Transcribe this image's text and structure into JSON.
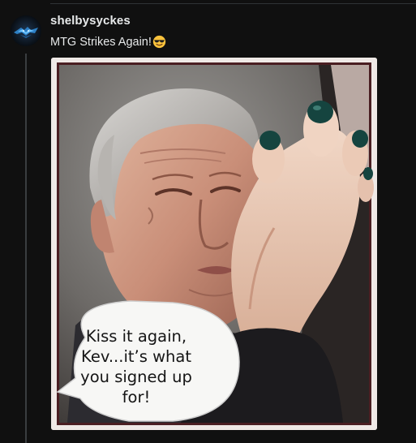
{
  "post": {
    "username": "shelbysyckes",
    "text": "MTG Strikes Again!",
    "emoji": "smiling-face-with-sunglasses-emoji"
  },
  "meme": {
    "caption": "Kiss it again,\nKev...it’s what\nyou signed up\nfor!"
  },
  "colors": {
    "background": "#101010",
    "text": "#e7e9ea",
    "thread_line": "#3a3d40",
    "nail_polish": "#15443f"
  }
}
